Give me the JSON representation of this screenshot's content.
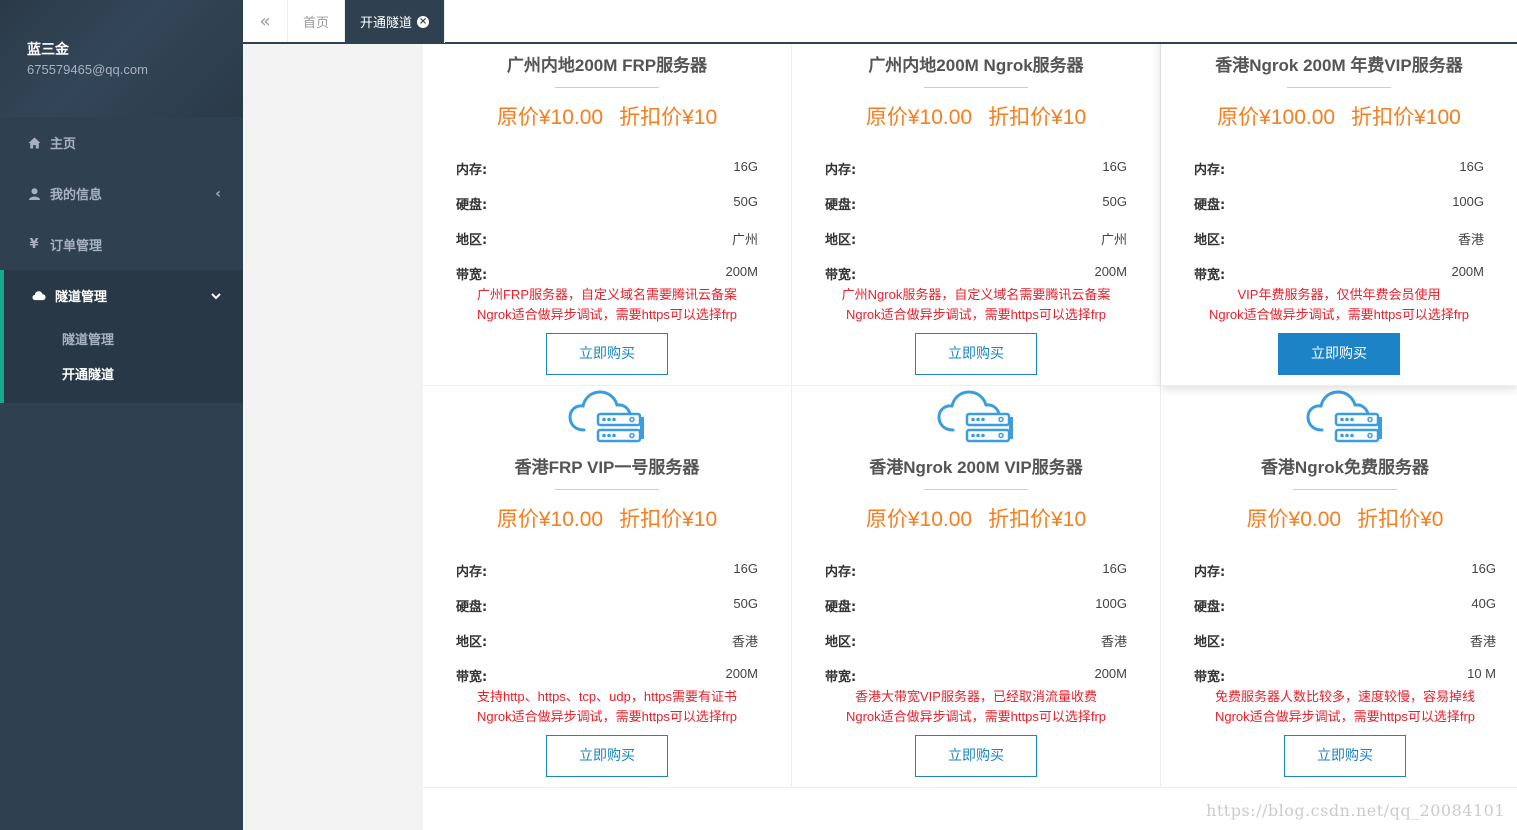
{
  "user": {
    "name": "蓝三金",
    "email": "675579465@qq.com"
  },
  "nav": {
    "items": [
      {
        "label": "主页",
        "icon": "home-icon"
      },
      {
        "label": "我的信息",
        "icon": "user-icon",
        "chevron": "‹"
      },
      {
        "label": "订单管理",
        "icon": "yen-icon"
      }
    ],
    "group": {
      "label": "隧道管理",
      "icon": "cloud-icon",
      "chevron": "⌄",
      "sub": [
        {
          "label": "隧道管理",
          "active": false
        },
        {
          "label": "开通隧道",
          "active": true
        }
      ]
    }
  },
  "tabs": {
    "back_icon": "«",
    "items": [
      {
        "label": "首页",
        "active": false
      },
      {
        "label": "开通隧道",
        "active": true,
        "close": "×"
      }
    ]
  },
  "spec_labels": {
    "mem": "内存:",
    "disk": "硬盘:",
    "region": "地区:",
    "bw": "带宽:"
  },
  "buy_label": "立即购买",
  "cards": [
    {
      "title": "广州内地200M FRP服务器",
      "orig": "原价¥10.00",
      "disc": "折扣价¥10",
      "mem": "16G",
      "disk": "50G",
      "region": "广州",
      "bw": "200M",
      "desc1": "广州FRP服务器，自定义域名需要腾讯云备案",
      "desc2": "Ngrok适合做异步调试，需要https可以选择frp"
    },
    {
      "title": "广州内地200M Ngrok服务器",
      "orig": "原价¥10.00",
      "disc": "折扣价¥10",
      "mem": "16G",
      "disk": "50G",
      "region": "广州",
      "bw": "200M",
      "desc1": "广州Ngrok服务器，自定义域名需要腾讯云备案",
      "desc2": "Ngrok适合做异步调试，需要https可以选择frp"
    },
    {
      "title": "香港Ngrok 200M 年费VIP服务器",
      "orig": "原价¥100.00",
      "disc": "折扣价¥100",
      "mem": "16G",
      "disk": "100G",
      "region": "香港",
      "bw": "200M",
      "desc1": "VIP年费服务器，仅供年费会员使用",
      "desc2": "Ngrok适合做异步调试，需要https可以选择frp"
    },
    {
      "title": "香港FRP VIP一号服务器",
      "orig": "原价¥10.00",
      "disc": "折扣价¥10",
      "mem": "16G",
      "disk": "50G",
      "region": "香港",
      "bw": "200M",
      "desc1": "支持http、https、tcp、udp，https需要有证书",
      "desc2": "Ngrok适合做异步调试，需要https可以选择frp"
    },
    {
      "title": "香港Ngrok 200M VIP服务器",
      "orig": "原价¥10.00",
      "disc": "折扣价¥10",
      "mem": "16G",
      "disk": "100G",
      "region": "香港",
      "bw": "200M",
      "desc1": "香港大带宽VIP服务器，已经取消流量收费",
      "desc2": "Ngrok适合做异步调试，需要https可以选择frp"
    },
    {
      "title": "香港Ngrok免费服务器",
      "orig": "原价¥0.00",
      "disc": "折扣价¥0",
      "mem": "16G",
      "disk": "40G",
      "region": "香港",
      "bw": "10 M",
      "desc1": "免费服务器人数比较多，速度较慢，容易掉线",
      "desc2": "Ngrok适合做异步调试，需要https可以选择frp"
    }
  ],
  "watermark": "https://blog.csdn.net/qq_20084101",
  "colors": {
    "sidebar": "#2f4050",
    "accent": "#19aa8d",
    "price": "#f77e1e",
    "desc": "#e8212b",
    "button": "#1c84c6"
  }
}
